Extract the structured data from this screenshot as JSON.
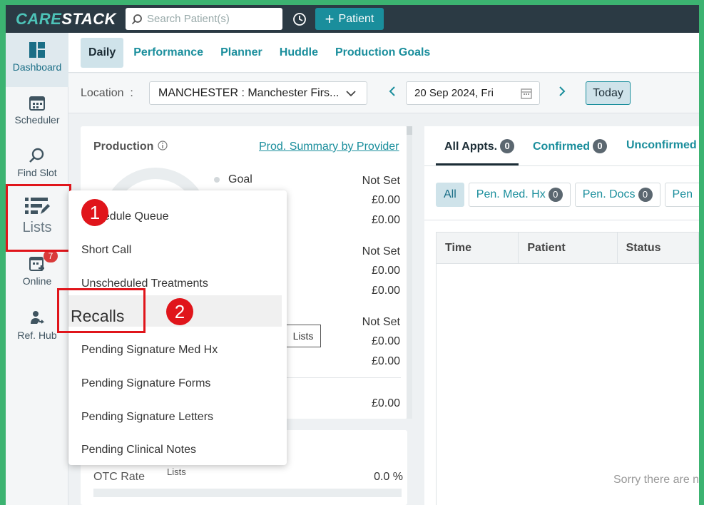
{
  "app": {
    "logo_part1": "CARE",
    "logo_part2": "STACK",
    "search_placeholder": "Search Patient(s)",
    "add_patient_label": "Patient"
  },
  "leftnav": {
    "items": [
      {
        "label": "Dashboard",
        "icon": "dashboard-icon"
      },
      {
        "label": "Scheduler",
        "icon": "calendar-icon"
      },
      {
        "label": "Find Slot",
        "icon": "search-icon"
      },
      {
        "label": "Lists",
        "icon": "list-edit-icon"
      },
      {
        "label": "Online",
        "icon": "calendar-plus-icon",
        "badge": "7"
      },
      {
        "label": "Ref. Hub",
        "icon": "user-referral-icon"
      }
    ]
  },
  "subnav": {
    "tabs": [
      "Daily",
      "Performance",
      "Planner",
      "Huddle",
      "Production Goals"
    ]
  },
  "locbar": {
    "label": "Location",
    "separator": ":",
    "location_value": "MANCHESTER : Manchester Firs...",
    "date_value": "20 Sep 2024, Fri",
    "today_label": "Today"
  },
  "production": {
    "title": "Production",
    "link": "Prod. Summary by Provider",
    "goal_label": "Goal",
    "rows": [
      {
        "value": "Not Set"
      },
      {
        "value": "£0.00"
      },
      {
        "value": "£0.00"
      },
      {
        "value": "Not Set"
      },
      {
        "value": "£0.00"
      },
      {
        "value": "£0.00"
      },
      {
        "value": "Not Set"
      },
      {
        "value": "£0.00"
      },
      {
        "value": "£0.00"
      },
      {
        "value": "£0.00"
      }
    ]
  },
  "otc": {
    "label": "OTC Rate",
    "value": "0.0 %",
    "lists_hint": "Lists"
  },
  "appointments": {
    "tabs": [
      {
        "label": "All Appts.",
        "count": "0"
      },
      {
        "label": "Confirmed",
        "count": "0"
      },
      {
        "label": "Unconfirmed",
        "count": ""
      }
    ],
    "filters": [
      {
        "label": "All",
        "count": ""
      },
      {
        "label": "Pen. Med. Hx",
        "count": "0"
      },
      {
        "label": "Pen. Docs",
        "count": "0"
      },
      {
        "label": "Pen",
        "count": ""
      }
    ],
    "columns": [
      "Time",
      "Patient",
      "Status"
    ],
    "empty_message": "Sorry there are n"
  },
  "tooltip": "Lists",
  "menu": {
    "items": [
      "Unscheduled Queue",
      "Short Call",
      "Unscheduled Treatments",
      "Recalls",
      "Pending Signature Med Hx",
      "Pending Signature Forms",
      "Pending Signature Letters",
      "Pending Clinical Notes"
    ],
    "visible_first_item": "hedule Queue"
  },
  "annotations": {
    "step1": "1",
    "step2": "2"
  },
  "colors": {
    "frame": "#3cb371",
    "topbar": "#2b3a44",
    "accent": "#1a8e9c",
    "highlight": "#e0151b"
  }
}
